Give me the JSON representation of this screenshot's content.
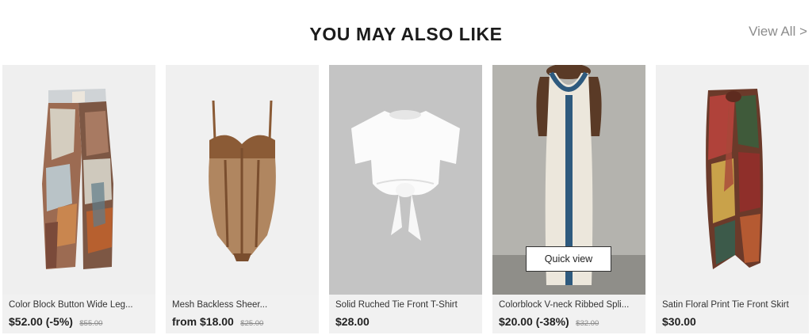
{
  "header": {
    "title": "YOU MAY ALSO LIKE",
    "view_all": "View All >"
  },
  "products": [
    {
      "name": "Color Block Button Wide Leg...",
      "price": "$52.00 (-5%)",
      "original_price": "$55.00",
      "image": "patchwork-wide-leg-pants"
    },
    {
      "name": "Mesh Backless Sheer...",
      "price": "from $18.00",
      "original_price": "$25.00",
      "image": "brown-mesh-bodysuit"
    },
    {
      "name": "Solid Ruched Tie Front T-Shirt",
      "price": "$28.00",
      "original_price": "",
      "image": "white-tie-front-tshirt"
    },
    {
      "name": "Colorblock V-neck Ribbed Spli...",
      "price": "$20.00 (-38%)",
      "original_price": "$32.00",
      "image": "cream-blue-ribbed-maxi-dress",
      "quick_view": "Quick view"
    },
    {
      "name": "Satin Floral Print Tie Front Skirt",
      "price": "$30.00",
      "original_price": "",
      "image": "floral-satin-wrap-skirt"
    }
  ],
  "colors": {
    "card_bg": "#f1f1f1",
    "title": "#1b1b1b",
    "view_all": "#8c8c8c",
    "strike": "#8a8a8a"
  }
}
